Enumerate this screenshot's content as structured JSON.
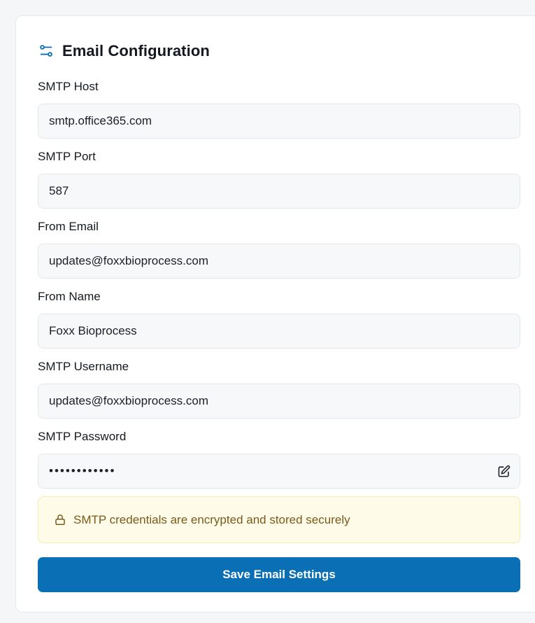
{
  "card": {
    "title": "Email Configuration",
    "icon": "sliders-icon"
  },
  "fields": [
    {
      "label": "SMTP Host",
      "value": "smtp.office365.com"
    },
    {
      "label": "SMTP Port",
      "value": "587"
    },
    {
      "label": "From Email",
      "value": "updates@foxxbioprocess.com"
    },
    {
      "label": "From Name",
      "value": "Foxx Bioprocess"
    },
    {
      "label": "SMTP Username",
      "value": "updates@foxxbioprocess.com"
    },
    {
      "label": "SMTP Password",
      "value": "••••••••••••",
      "icon": "edit-icon"
    }
  ],
  "notice": {
    "text": "SMTP credentials are encrypted and stored securely",
    "icon": "lock-icon"
  },
  "actions": {
    "save_label": "Save Email Settings"
  },
  "colors": {
    "accent": "#0a6fb5",
    "notice_bg": "#fefbe8",
    "notice_text": "#7a5a1b",
    "input_bg": "#f7f8fa"
  }
}
